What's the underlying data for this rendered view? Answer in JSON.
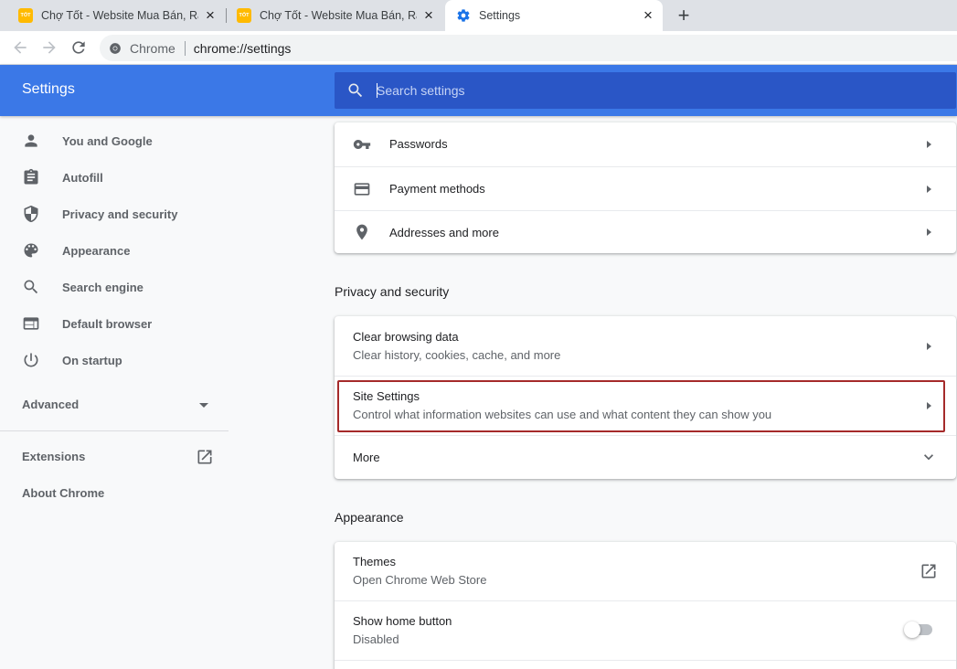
{
  "tabs": [
    {
      "title": "Chợ Tốt - Website Mua Bán, Rao",
      "favicon_text": "TỐT",
      "active": false
    },
    {
      "title": "Chợ Tốt - Website Mua Bán, Rao",
      "favicon_text": "TỐT",
      "active": false
    },
    {
      "title": "Settings",
      "active": true
    }
  ],
  "omnibox": {
    "site": "Chrome",
    "url": "chrome://settings"
  },
  "header": {
    "title": "Settings",
    "search_placeholder": "Search settings"
  },
  "sidebar": {
    "items": [
      {
        "label": "You and Google",
        "icon": "person-icon"
      },
      {
        "label": "Autofill",
        "icon": "clipboard-icon"
      },
      {
        "label": "Privacy and security",
        "icon": "shield-icon"
      },
      {
        "label": "Appearance",
        "icon": "palette-icon"
      },
      {
        "label": "Search engine",
        "icon": "search-icon"
      },
      {
        "label": "Default browser",
        "icon": "browser-icon"
      },
      {
        "label": "On startup",
        "icon": "power-icon"
      }
    ],
    "advanced": "Advanced",
    "extensions": "Extensions",
    "about": "About Chrome"
  },
  "autofill_card": {
    "rows": [
      {
        "label": "Passwords",
        "icon": "key-icon"
      },
      {
        "label": "Payment methods",
        "icon": "credit-card-icon"
      },
      {
        "label": "Addresses and more",
        "icon": "location-pin-icon"
      }
    ]
  },
  "privacy": {
    "section_title": "Privacy and security",
    "rows": [
      {
        "title": "Clear browsing data",
        "subtitle": "Clear history, cookies, cache, and more"
      },
      {
        "title": "Site Settings",
        "subtitle": "Control what information websites can use and what content they can show you"
      }
    ],
    "more": "More"
  },
  "appearance": {
    "section_title": "Appearance",
    "themes_title": "Themes",
    "themes_sub": "Open Chrome Web Store",
    "home_title": "Show home button",
    "home_sub": "Disabled",
    "home_enabled": false
  },
  "colors": {
    "header_blue": "#3b78e7",
    "search_blue": "#2a56c6",
    "highlight": "#a52a2a",
    "favicon": "#ffba00"
  }
}
